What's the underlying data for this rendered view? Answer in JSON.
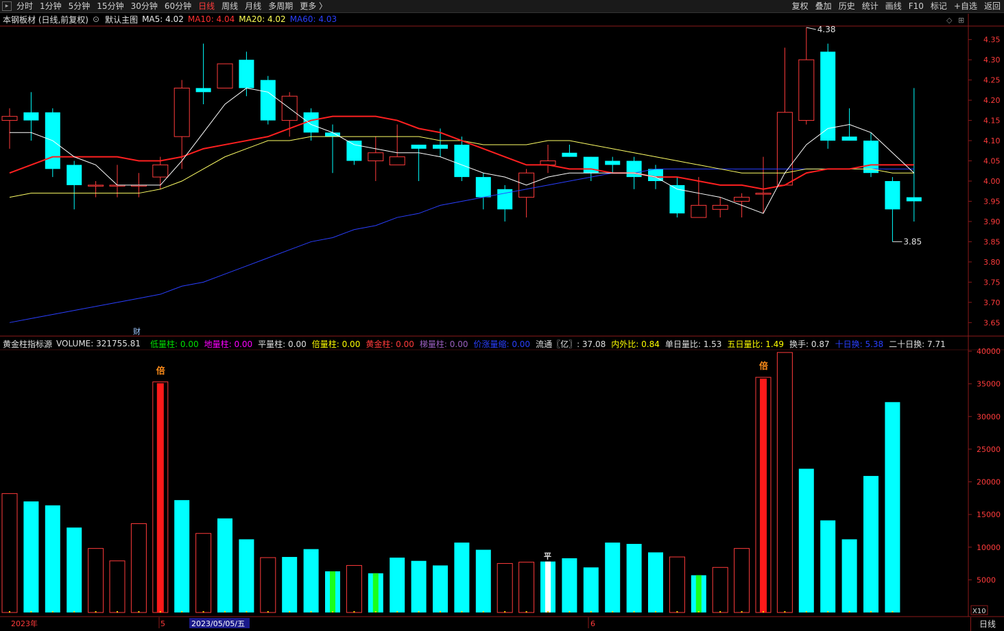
{
  "toolbar": {
    "left_items": [
      "分时",
      "1分钟",
      "5分钟",
      "15分钟",
      "30分钟",
      "60分钟",
      "日线",
      "周线",
      "月线",
      "多周期",
      "更多 〉"
    ],
    "active": "日线",
    "right_items": [
      "复权",
      "叠加",
      "历史",
      "统计",
      "画线",
      "F10",
      "标记",
      "+自选",
      "返回"
    ]
  },
  "main_info": {
    "title": "本钢板材 (日线,前复权)",
    "chart_name": "默认主图",
    "ma5": "MA5: 4.02",
    "ma10": "MA10: 4.04",
    "ma20": "MA20: 4.02",
    "ma60": "MA60: 4.03"
  },
  "volume_info": {
    "name": "黄金柱指标源",
    "volume": "VOLUME: 321755.81",
    "items": [
      {
        "label": "低量柱: 0.00",
        "color": "#00e000"
      },
      {
        "label": "地量柱: 0.00",
        "color": "#ff00ff"
      },
      {
        "label": "平量柱: 0.00",
        "color": "#e0e0e0"
      },
      {
        "label": "倍量柱: 0.00",
        "color": "#ffff00"
      },
      {
        "label": "黄金柱: 0.00",
        "color": "#ff3b3b"
      },
      {
        "label": "梯量柱: 0.00",
        "color": "#9a5fbf"
      },
      {
        "label": "价涨量缩: 0.00",
        "color": "#2a3fff"
      },
      {
        "label": "流通〖亿〗: 37.08",
        "color": "#e0e0e0"
      },
      {
        "label": "内外比: 0.84",
        "color": "#ffff00"
      },
      {
        "label": "单日量比: 1.53",
        "color": "#e0e0e0"
      },
      {
        "label": "五日量比: 1.49",
        "color": "#ffff00"
      },
      {
        "label": "换手: 0.87",
        "color": "#e0e0e0"
      },
      {
        "label": "十日换: 5.38",
        "color": "#2a3fff"
      },
      {
        "label": "二十日换: 7.71",
        "color": "#e0e0e0"
      }
    ]
  },
  "bottom": {
    "date_labels": [
      "2023年",
      "5",
      "2023/05/05/五",
      "6"
    ],
    "period": "日线",
    "x10": "X10"
  },
  "colors": {
    "up": "#ff3b3b",
    "down": "#00ffff",
    "ma5": "#ffffff",
    "ma10": "#ff2020",
    "ma20": "#ffff66",
    "ma60": "#2a3fff",
    "axis": "#8b1a1a"
  },
  "chart_data": [
    {
      "type": "candlestick",
      "ylim": [
        3.62,
        4.38
      ],
      "price_ticks": [
        "4.35",
        "4.30",
        "4.25",
        "4.20",
        "4.15",
        "4.10",
        "4.05",
        "4.00",
        "3.95",
        "3.90",
        "3.85",
        "3.80",
        "3.75",
        "3.70",
        "3.65"
      ],
      "high_label": "4.38",
      "low_label": "3.85",
      "candles": [
        {
          "o": 4.15,
          "c": 4.16,
          "h": 4.18,
          "l": 4.08
        },
        {
          "o": 4.17,
          "c": 4.15,
          "h": 4.22,
          "l": 4.1
        },
        {
          "o": 4.17,
          "c": 4.03,
          "h": 4.18,
          "l": 4.01
        },
        {
          "o": 4.04,
          "c": 3.99,
          "h": 4.05,
          "l": 3.93
        },
        {
          "o": 3.99,
          "c": 3.99,
          "h": 4.0,
          "l": 3.96
        },
        {
          "o": 3.99,
          "c": 3.99,
          "h": 4.04,
          "l": 3.96
        },
        {
          "o": 3.99,
          "c": 3.99,
          "h": 4.02,
          "l": 3.96
        },
        {
          "o": 4.01,
          "c": 4.04,
          "h": 4.06,
          "l": 3.98
        },
        {
          "o": 4.11,
          "c": 4.23,
          "h": 4.25,
          "l": 4.03
        },
        {
          "o": 4.23,
          "c": 4.22,
          "h": 4.34,
          "l": 4.19
        },
        {
          "o": 4.23,
          "c": 4.29,
          "h": 4.29,
          "l": 4.23
        },
        {
          "o": 4.3,
          "c": 4.23,
          "h": 4.32,
          "l": 4.21
        },
        {
          "o": 4.25,
          "c": 4.15,
          "h": 4.26,
          "l": 4.14
        },
        {
          "o": 4.15,
          "c": 4.21,
          "h": 4.22,
          "l": 4.11
        },
        {
          "o": 4.17,
          "c": 4.12,
          "h": 4.18,
          "l": 4.1
        },
        {
          "o": 4.12,
          "c": 4.11,
          "h": 4.14,
          "l": 4.02
        },
        {
          "o": 4.1,
          "c": 4.05,
          "h": 4.1,
          "l": 4.04
        },
        {
          "o": 4.05,
          "c": 4.07,
          "h": 4.11,
          "l": 4.0
        },
        {
          "o": 4.04,
          "c": 4.06,
          "h": 4.14,
          "l": 4.04
        },
        {
          "o": 4.09,
          "c": 4.08,
          "h": 4.09,
          "l": 4.0
        },
        {
          "o": 4.09,
          "c": 4.08,
          "h": 4.13,
          "l": 4.06
        },
        {
          "o": 4.09,
          "c": 4.01,
          "h": 4.11,
          "l": 4.0
        },
        {
          "o": 4.01,
          "c": 3.96,
          "h": 4.02,
          "l": 3.93
        },
        {
          "o": 3.98,
          "c": 3.93,
          "h": 3.99,
          "l": 3.9
        },
        {
          "o": 3.96,
          "c": 4.02,
          "h": 4.03,
          "l": 3.91
        },
        {
          "o": 4.04,
          "c": 4.05,
          "h": 4.09,
          "l": 4.02
        },
        {
          "o": 4.07,
          "c": 4.06,
          "h": 4.09,
          "l": 4.06
        },
        {
          "o": 4.06,
          "c": 4.02,
          "h": 4.06,
          "l": 4.0
        },
        {
          "o": 4.05,
          "c": 4.04,
          "h": 4.06,
          "l": 4.02
        },
        {
          "o": 4.05,
          "c": 4.01,
          "h": 4.06,
          "l": 3.98
        },
        {
          "o": 4.03,
          "c": 4.0,
          "h": 4.04,
          "l": 3.98
        },
        {
          "o": 3.99,
          "c": 3.92,
          "h": 4.01,
          "l": 3.91
        },
        {
          "o": 3.91,
          "c": 3.94,
          "h": 4.01,
          "l": 3.91
        },
        {
          "o": 3.93,
          "c": 3.94,
          "h": 3.96,
          "l": 3.91
        },
        {
          "o": 3.95,
          "c": 3.96,
          "h": 3.97,
          "l": 3.91
        },
        {
          "o": 3.97,
          "c": 3.97,
          "h": 4.06,
          "l": 3.92
        },
        {
          "o": 3.99,
          "c": 4.17,
          "h": 4.33,
          "l": 3.99
        },
        {
          "o": 4.15,
          "c": 4.3,
          "h": 4.38,
          "l": 4.14
        },
        {
          "o": 4.32,
          "c": 4.1,
          "h": 4.34,
          "l": 4.08
        },
        {
          "o": 4.11,
          "c": 4.1,
          "h": 4.18,
          "l": 4.1
        },
        {
          "o": 4.1,
          "c": 4.02,
          "h": 4.12,
          "l": 4.01
        },
        {
          "o": 4.0,
          "c": 3.93,
          "h": 4.01,
          "l": 3.85
        },
        {
          "o": 3.96,
          "c": 3.95,
          "h": 4.23,
          "l": 3.9
        }
      ],
      "ma5": [
        4.12,
        4.12,
        4.1,
        4.06,
        4.04,
        3.99,
        3.99,
        3.99,
        4.05,
        4.12,
        4.19,
        4.23,
        4.22,
        4.18,
        4.14,
        4.12,
        4.09,
        4.08,
        4.07,
        4.07,
        4.06,
        4.04,
        4.02,
        4.01,
        3.99,
        4.01,
        4.02,
        4.02,
        4.02,
        4.02,
        4.01,
        3.98,
        3.97,
        3.96,
        3.94,
        3.92,
        4.02,
        4.09,
        4.13,
        4.14,
        4.12,
        4.07,
        4.02
      ],
      "ma10": [
        4.02,
        4.04,
        4.06,
        4.06,
        4.06,
        4.06,
        4.05,
        4.05,
        4.06,
        4.08,
        4.09,
        4.1,
        4.11,
        4.13,
        4.15,
        4.16,
        4.16,
        4.16,
        4.15,
        4.13,
        4.12,
        4.1,
        4.08,
        4.06,
        4.04,
        4.04,
        4.03,
        4.03,
        4.02,
        4.02,
        4.01,
        4.01,
        4.0,
        3.99,
        3.99,
        3.98,
        3.99,
        4.02,
        4.03,
        4.03,
        4.04,
        4.04,
        4.04
      ],
      "ma20": [
        3.96,
        3.97,
        3.97,
        3.97,
        3.97,
        3.97,
        3.97,
        3.98,
        4.0,
        4.03,
        4.06,
        4.08,
        4.1,
        4.1,
        4.11,
        4.11,
        4.11,
        4.11,
        4.11,
        4.11,
        4.1,
        4.1,
        4.09,
        4.09,
        4.09,
        4.1,
        4.1,
        4.09,
        4.08,
        4.07,
        4.06,
        4.05,
        4.04,
        4.03,
        4.02,
        4.02,
        4.02,
        4.03,
        4.03,
        4.03,
        4.03,
        4.02,
        4.02
      ],
      "ma60": [
        3.65,
        3.66,
        3.67,
        3.68,
        3.69,
        3.7,
        3.71,
        3.72,
        3.74,
        3.75,
        3.77,
        3.79,
        3.81,
        3.83,
        3.85,
        3.86,
        3.88,
        3.89,
        3.91,
        3.92,
        3.94,
        3.95,
        3.96,
        3.97,
        3.98,
        3.99,
        4.0,
        4.01,
        4.02,
        4.02,
        4.03,
        4.03,
        4.03,
        4.03,
        4.03,
        4.03,
        4.03,
        4.03,
        4.03,
        4.03,
        4.03,
        4.03,
        4.03
      ]
    },
    {
      "type": "bar",
      "ylim": [
        0,
        40000
      ],
      "volume_ticks": [
        "40000",
        "35000",
        "30000",
        "25000",
        "20000",
        "15000",
        "10000",
        "5000"
      ],
      "values": [
        18200,
        17000,
        16400,
        13000,
        9800,
        7900,
        13600,
        35300,
        17200,
        12100,
        14400,
        11200,
        8400,
        8500,
        9700,
        6300,
        7200,
        6000,
        8400,
        7900,
        7200,
        10700,
        9600,
        7500,
        7700,
        7800,
        8300,
        6900,
        10700,
        10500,
        9200,
        8500,
        5700,
        6900,
        9800,
        36000,
        39800,
        22000,
        14100,
        11200,
        20900,
        32200
      ],
      "kinds": [
        "up",
        "down",
        "down",
        "down",
        "up",
        "up",
        "up",
        "gold",
        "down",
        "up",
        "down",
        "down",
        "up",
        "down",
        "down",
        "low",
        "up",
        "low",
        "down",
        "down",
        "down",
        "down",
        "down",
        "up",
        "up",
        "flat",
        "down",
        "down",
        "down",
        "down",
        "down",
        "up",
        "low",
        "up",
        "up",
        "gold",
        "up",
        "down",
        "down",
        "down",
        "down",
        "down"
      ],
      "markers": [
        {
          "index": 7,
          "text": "倍"
        },
        {
          "index": 35,
          "text": "倍"
        },
        {
          "index": 25,
          "text": "平"
        }
      ]
    }
  ],
  "event_marker": "财"
}
